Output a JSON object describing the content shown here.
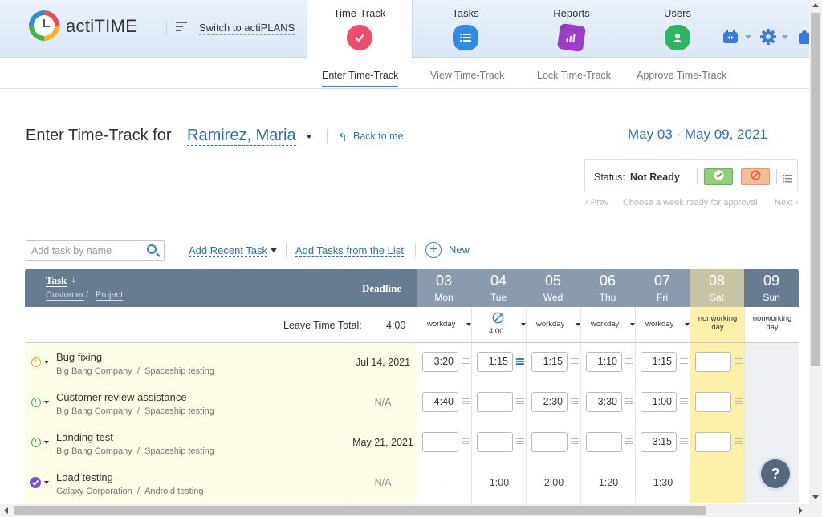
{
  "app": {
    "brand": "actiTIME",
    "switch_label": "Switch to actiPLANS"
  },
  "nav": {
    "tabs": [
      {
        "label": "Time-Track",
        "icon": "check-icon",
        "color": "#ee4c6b"
      },
      {
        "label": "Tasks",
        "icon": "list-icon",
        "color": "#2f8ae8"
      },
      {
        "label": "Reports",
        "icon": "bar-chart-icon",
        "color": "#9b3ec7"
      },
      {
        "label": "Users",
        "icon": "user-icon",
        "color": "#2fb55e"
      }
    ],
    "subtabs": [
      "Enter Time-Track",
      "View Time-Track",
      "Lock Time-Track",
      "Approve Time-Track"
    ]
  },
  "page": {
    "title": "Enter Time-Track for",
    "user": "Ramirez, Maria",
    "back_label": "Back to me",
    "date_range": "May 03 - May 09, 2021",
    "status_label": "Status:",
    "status_value": "Not Ready",
    "prev": "Prev",
    "next": "Next",
    "week_hint": "Choose a week ready for approval"
  },
  "toolbar": {
    "search_placeholder": "Add task by name",
    "add_recent": "Add Recent Task",
    "add_from_list": "Add Tasks from the List",
    "new": "New"
  },
  "table": {
    "task_header": "Task",
    "customer_header": "Customer",
    "project_header": "Project",
    "deadline_header": "Deadline",
    "leave_total_label": "Leave Time Total:",
    "leave_total_value": "4:00",
    "days": [
      {
        "num": "03",
        "name": "Mon",
        "type": "workday",
        "leave": ""
      },
      {
        "num": "04",
        "name": "Tue",
        "type": "",
        "leave": "4:00"
      },
      {
        "num": "05",
        "name": "Wed",
        "type": "workday",
        "leave": ""
      },
      {
        "num": "06",
        "name": "Thu",
        "type": "workday",
        "leave": ""
      },
      {
        "num": "07",
        "name": "Fri",
        "type": "workday",
        "leave": ""
      },
      {
        "num": "08",
        "name": "Sat",
        "type": "nonworking day",
        "leave": ""
      },
      {
        "num": "09",
        "name": "Sun",
        "type": "nonworking day",
        "leave": ""
      }
    ],
    "rows": [
      {
        "name": "Bug fixing",
        "customer": "Big Bang Company",
        "project": "Spaceship testing",
        "deadline": "Jul 14, 2021",
        "times": [
          "3:20",
          "1:15",
          "1:15",
          "1:10",
          "1:15",
          ""
        ],
        "color": "#f0a020"
      },
      {
        "name": "Customer review assistance",
        "customer": "Big Bang Company",
        "project": "Spaceship testing",
        "deadline": "N/A",
        "times": [
          "4:40",
          "",
          "2:30",
          "3:30",
          "1:00",
          ""
        ],
        "color": "#2fb58a"
      },
      {
        "name": "Landing test",
        "customer": "Big Bang Company",
        "project": "Spaceship testing",
        "deadline": "May 21, 2021",
        "times": [
          "",
          "",
          "",
          "",
          "3:15",
          ""
        ],
        "color": "#3fb24a"
      },
      {
        "name": "Load testing",
        "customer": "Galaxy Corporation",
        "project": "Android testing",
        "deadline": "N/A",
        "times": [
          "--",
          "1:00",
          "2:00",
          "1:20",
          "1:30",
          "--"
        ],
        "color": "#7a4fd3"
      }
    ]
  },
  "help_label": "?"
}
